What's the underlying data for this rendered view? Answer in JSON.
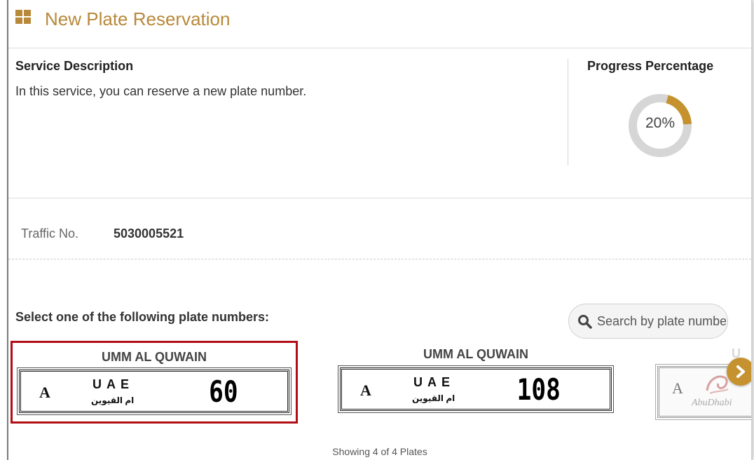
{
  "header": {
    "title": "New Plate Reservation",
    "icon": "grid-icon",
    "accent": "#b8893a"
  },
  "service": {
    "label": "Service Description",
    "description": "In this service, you can reserve a new plate number."
  },
  "progress": {
    "label": "Progress Percentage",
    "value_text": "20%",
    "value": 0.2,
    "color": "#c6922f"
  },
  "traffic": {
    "label": "Traffic No.",
    "value": "5030005521"
  },
  "selection": {
    "prompt": "Select one of the following plate numbers:"
  },
  "search": {
    "placeholder": "Search by plate number"
  },
  "plates": [
    {
      "emirate": "UMM AL QUWAIN",
      "code": "A",
      "country": "UAE",
      "arabic": "ام القيوين",
      "number": "60",
      "selected": true
    },
    {
      "emirate": "UMM AL QUWAIN",
      "code": "A",
      "country": "UAE",
      "arabic": "ام القيوين",
      "number": "108",
      "selected": false
    },
    {
      "emirate": "U",
      "code": "A",
      "city": "AbuDhabi",
      "selected": false
    }
  ],
  "footer": {
    "showing_text": "Showing 4 of 4 Plates"
  }
}
